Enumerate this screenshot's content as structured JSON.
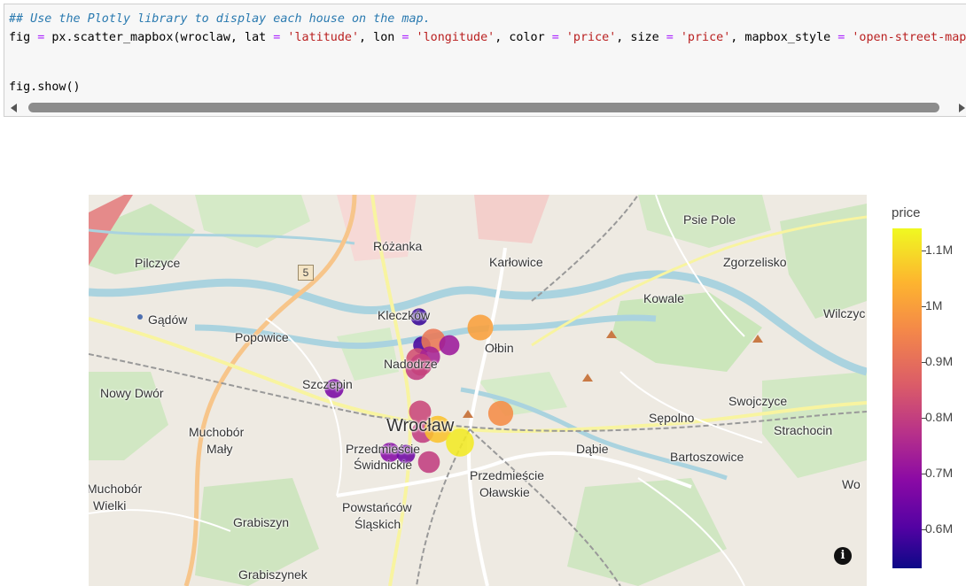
{
  "code_cell": {
    "comment": "## Use the Plotly library to display each house on the map.",
    "line2": {
      "p1": "fig ",
      "eq1": "=",
      "p2": " px.scatter_mapbox(wroclaw, lat ",
      "eq2": "=",
      "s1": " 'latitude'",
      "p3": ", lon ",
      "eq3": "=",
      "s2": " 'longitude'",
      "p4": ", color ",
      "eq4": "=",
      "s3": " 'price'",
      "p5": ", size ",
      "eq5": "=",
      "s4": " 'price'",
      "p6": ", mapbox_style ",
      "eq6": "=",
      "s5": " 'open-street-map"
    },
    "line3": "fig.show()"
  },
  "map": {
    "labels": [
      {
        "text": "Psie Pole"
      },
      {
        "text": "Różanka"
      },
      {
        "text": "Karłowice"
      },
      {
        "text": "Pilczyce"
      },
      {
        "text": "Zgorzelisko"
      },
      {
        "text": "Kowale"
      },
      {
        "text": "Wilczyc"
      },
      {
        "text": "Gądów"
      },
      {
        "text": "Kleczków"
      },
      {
        "text": "Popowice"
      },
      {
        "text": "Ołbin"
      },
      {
        "text": "Nadodrze"
      },
      {
        "text": "Szczepin"
      },
      {
        "text": "Nowy Dwór"
      },
      {
        "text": "Swojczyce"
      },
      {
        "text": "Sępolno"
      },
      {
        "text": "Strachocin"
      },
      {
        "text": "Muchobór"
      },
      {
        "text": "Mały"
      },
      {
        "text": "Wrocław"
      },
      {
        "text": "Przedmieście"
      },
      {
        "text": "Świdnickie"
      },
      {
        "text": "Dąbie"
      },
      {
        "text": "Bartoszowice"
      },
      {
        "text": "Przedmieście"
      },
      {
        "text": "Oławskie"
      },
      {
        "text": "Wo"
      },
      {
        "text": "Muchobór"
      },
      {
        "text": "Wielki"
      },
      {
        "text": "Powstańców"
      },
      {
        "text": "Śląskich"
      },
      {
        "text": "Grabiszyn"
      },
      {
        "text": "Grabiszynek"
      }
    ],
    "road_shield": "5",
    "info_icon": "i"
  },
  "colorbar": {
    "title": "price",
    "ticks": [
      "1.1M",
      "1M",
      "0.9M",
      "0.8M",
      "0.7M",
      "0.6M"
    ]
  },
  "chart_data": {
    "type": "scatter",
    "title": "",
    "color_by": "price",
    "size_by": "price",
    "mapbox_style": "open-street-map",
    "colorscale": [
      "#0d0887",
      "#5302a3",
      "#8b0aa5",
      "#b83289",
      "#db5c68",
      "#f48849",
      "#fdb42f",
      "#f0f921"
    ],
    "color_range": [
      0.53,
      1.15
    ],
    "points": [
      {
        "price": 0.58
      },
      {
        "price": 1.02
      },
      {
        "price": 0.6
      },
      {
        "price": 0.94
      },
      {
        "price": 0.74
      },
      {
        "price": 0.86
      },
      {
        "price": 0.76
      },
      {
        "price": 0.82
      },
      {
        "price": 0.83
      },
      {
        "price": 0.68
      },
      {
        "price": 0.84
      },
      {
        "price": 0.98
      },
      {
        "price": 0.82
      },
      {
        "price": 1.08
      },
      {
        "price": 1.13
      },
      {
        "price": 0.7
      },
      {
        "price": 0.66
      },
      {
        "price": 0.82
      }
    ]
  }
}
